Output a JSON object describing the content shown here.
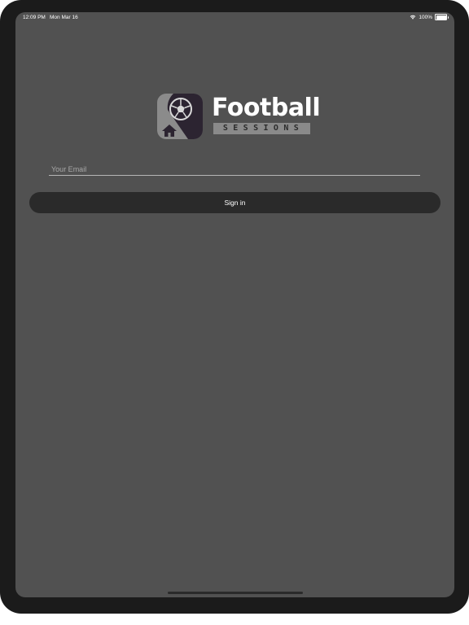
{
  "status_bar": {
    "time": "12:09 PM",
    "date": "Mon Mar 16",
    "battery": "100%",
    "battery_level": 1.0
  },
  "logo": {
    "icon": "football-home-icon",
    "word": "Football",
    "sub": "SESSIONS"
  },
  "login": {
    "email_placeholder": "Your Email",
    "email_value": "",
    "sign_in_label": "Sign in"
  },
  "colors": {
    "background": "#515151",
    "device_bezel": "#1b1b1b",
    "button": "#2a2a2a",
    "text": "#ffffff"
  }
}
